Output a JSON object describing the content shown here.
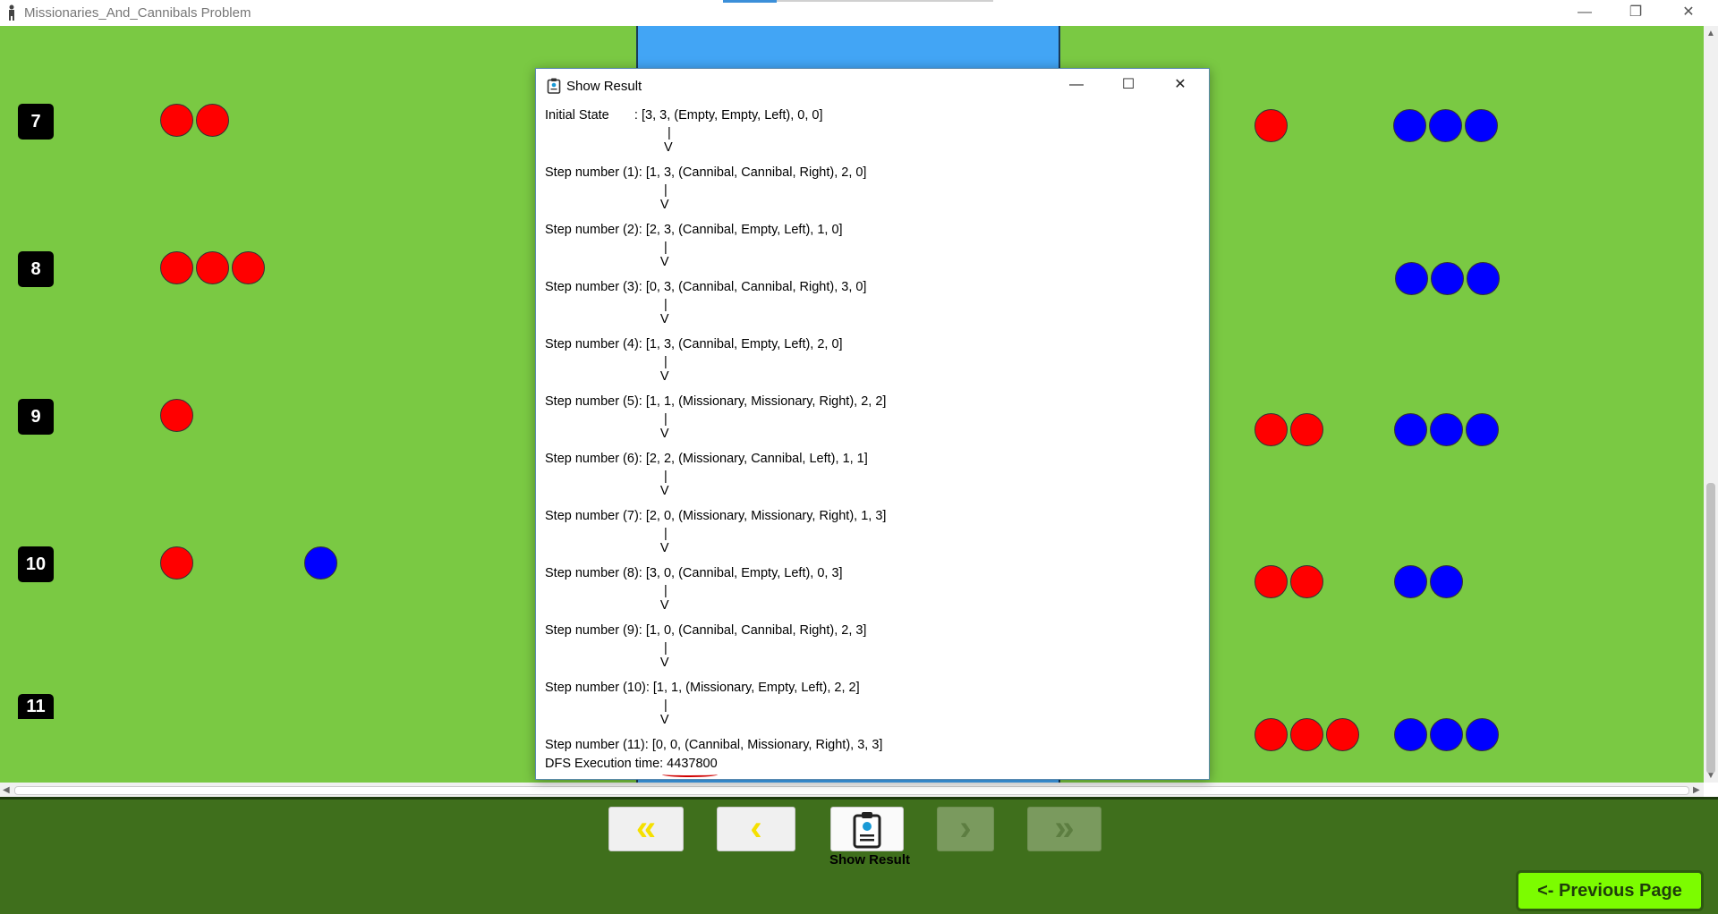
{
  "app": {
    "title": "Missionaries_And_Cannibals Problem",
    "controls": [
      "—",
      "❐",
      "✕"
    ]
  },
  "board": {
    "step_numbers": [
      "7",
      "8",
      "9",
      "10",
      "11"
    ],
    "colors": {
      "ground": "#7ac943",
      "river": "#42a5f5",
      "cannibal": "#ff0000",
      "missionary": "#0000ff"
    }
  },
  "dialog": {
    "title": "Show Result",
    "lines": [
      "Initial State       : [3, 3, (Empty, Empty, Left), 0, 0]",
      "                                  |",
      "                                 V",
      "Step number (1): [1, 3, (Cannibal, Cannibal, Right), 2, 0]",
      "                                 |",
      "                                V",
      "Step number (2): [2, 3, (Cannibal, Empty, Left), 1, 0]",
      "                                 |",
      "                                V",
      "Step number (3): [0, 3, (Cannibal, Cannibal, Right), 3, 0]",
      "                                 |",
      "                                V",
      "Step number (4): [1, 3, (Cannibal, Empty, Left), 2, 0]",
      "                                 |",
      "                                V",
      "Step number (5): [1, 1, (Missionary, Missionary, Right), 2, 2]",
      "                                 |",
      "                                V",
      "Step number (6): [2, 2, (Missionary, Cannibal, Left), 1, 1]",
      "                                 |",
      "                                V",
      "Step number (7): [2, 0, (Missionary, Missionary, Right), 1, 3]",
      "                                 |",
      "                                V",
      "Step number (8): [3, 0, (Cannibal, Empty, Left), 0, 3]",
      "                                 |",
      "                                V",
      "Step number (9): [1, 0, (Cannibal, Cannibal, Right), 2, 3]",
      "                                 |",
      "                                V",
      "Step number (10): [1, 1, (Missionary, Empty, Left), 2, 2]",
      "                                 |",
      "                                V",
      "Step number (11): [0, 0, (Cannibal, Missionary, Right), 3, 3]",
      "DFS Execution time: 4437800"
    ]
  },
  "nav": {
    "first_label": "«",
    "prev_label": "‹",
    "next_label": "›",
    "last_label": "»",
    "show_result_label": "Show Result",
    "previous_page_label": "<- Previous Page"
  }
}
